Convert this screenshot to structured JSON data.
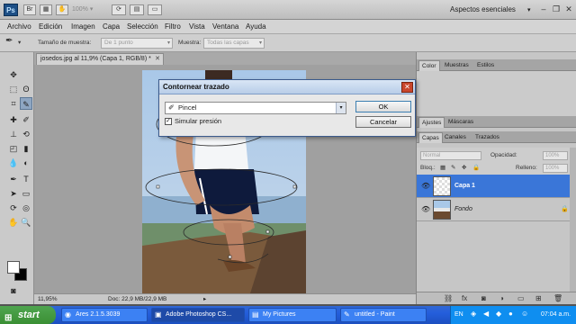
{
  "app": {
    "logo": "Ps",
    "zoom": "100%",
    "workspace": "Aspectos esenciales"
  },
  "menu": [
    "Archivo",
    "Edición",
    "Imagen",
    "Capa",
    "Selección",
    "Filtro",
    "Vista",
    "Ventana",
    "Ayuda"
  ],
  "options": {
    "sample_size_label": "Tamaño de muestra:",
    "sample_size_value": "De 1 punto",
    "sample_label": "Muestra:",
    "sample_value": "Todas las capas"
  },
  "document": {
    "tab": "josedos.jpg al 11,9% (Capa 1, RGB/8) *",
    "zoom": "11,95%",
    "doc_info": "Doc: 22,9 MB/22,9 MB"
  },
  "dialog": {
    "title": "Contornear trazado",
    "tool": "Pincel",
    "simulate_pressure": "Simular presión",
    "simulate_checked": true,
    "ok": "OK",
    "cancel": "Cancelar"
  },
  "panels": {
    "top_tabs": [
      "Color",
      "Muestras",
      "Estilos"
    ],
    "mid_tabs": [
      "Ajustes",
      "Máscaras"
    ],
    "layers_tabs": [
      "Capas",
      "Canales",
      "Trazados"
    ],
    "blend_mode": "Normal",
    "opacity_label": "Opacidad:",
    "opacity_value": "100%",
    "lock_label": "Bloq.:",
    "fill_label": "Relleno:",
    "fill_value": "100%",
    "layers": [
      {
        "name": "Capa 1",
        "selected": true
      },
      {
        "name": "Fondo",
        "selected": false
      }
    ]
  },
  "taskbar": {
    "start": "start",
    "tasks": [
      "Ares 2.1.5.3039",
      "Adobe Photoshop CS...",
      "My Pictures",
      "untitled - Paint"
    ],
    "language": "EN",
    "clock": "07:04 a.m."
  },
  "colors": {
    "dialog_accent": "#3c7fb1",
    "layer_selected": "#3a76d8",
    "taskbar": "#245edb",
    "start": "#3a8f34"
  }
}
